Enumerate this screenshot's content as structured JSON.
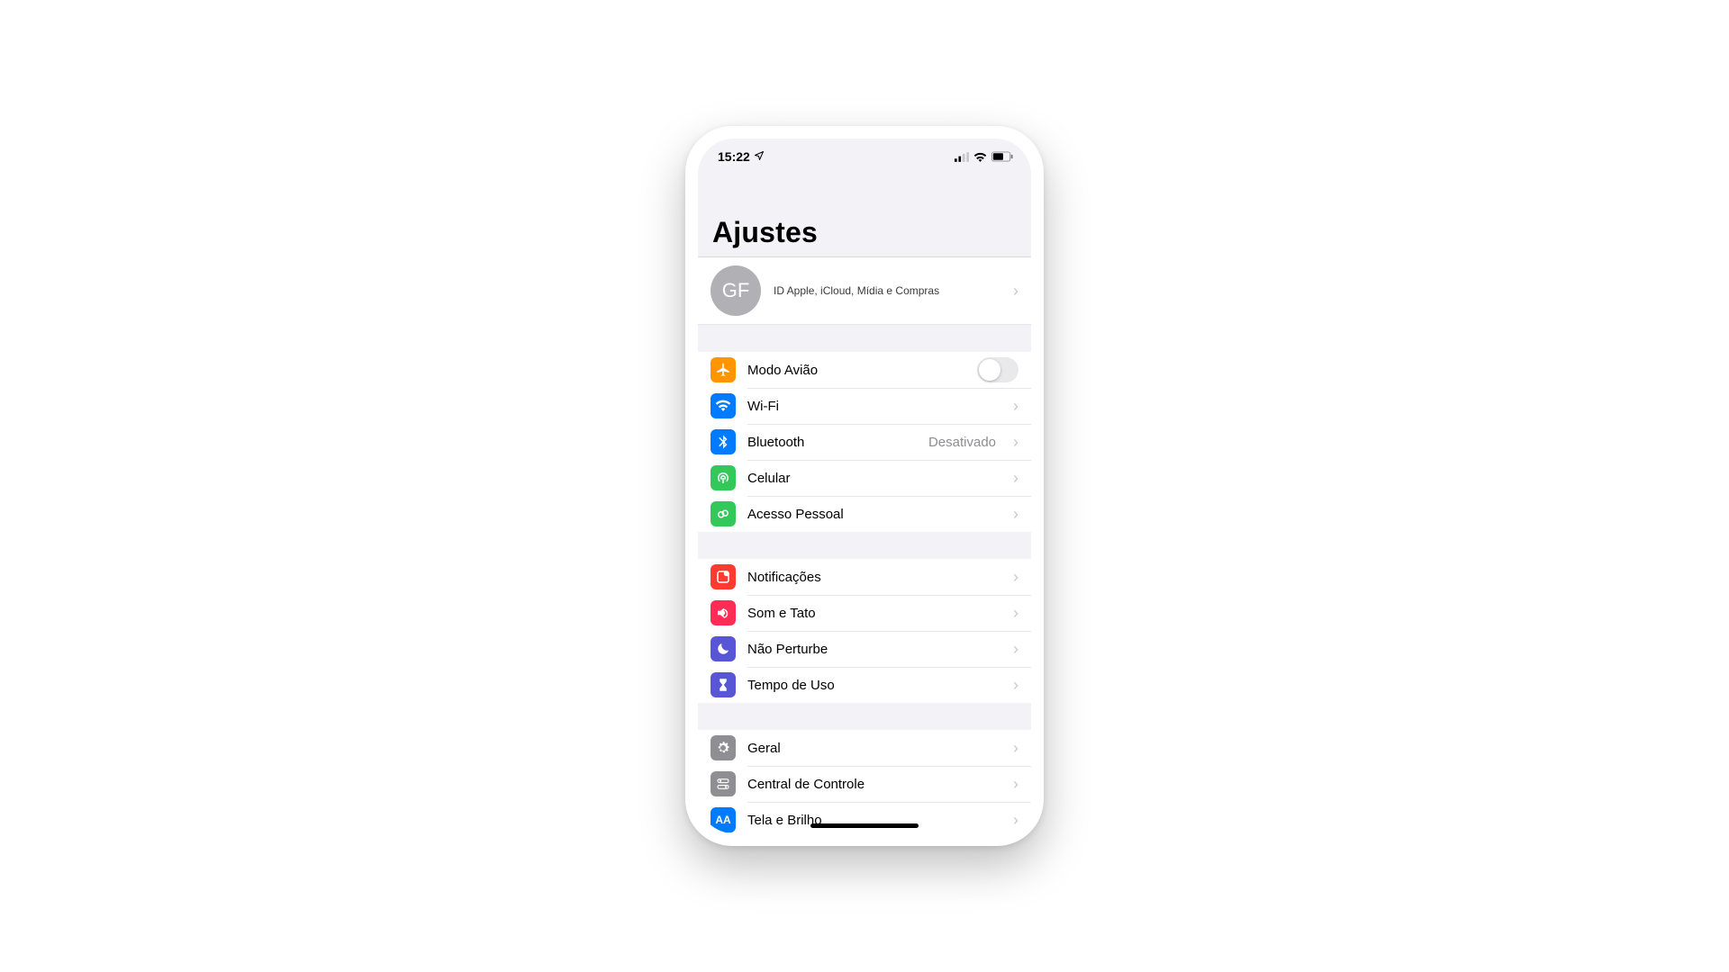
{
  "status": {
    "time": "15:22",
    "location_services": true
  },
  "header": {
    "title": "Ajustes"
  },
  "profile": {
    "initials": "GF",
    "subtitle": "ID Apple, iCloud, Mídia e Compras"
  },
  "groups": [
    {
      "id": "connectivity",
      "rows": [
        {
          "id": "airplane",
          "icon": "airplane",
          "icon_color": "#ff9500",
          "label": "Modo Avião",
          "type": "toggle",
          "toggled": false
        },
        {
          "id": "wifi",
          "icon": "wifi",
          "icon_color": "#007aff",
          "label": "Wi-Fi",
          "type": "nav",
          "value": ""
        },
        {
          "id": "bluetooth",
          "icon": "bluetooth",
          "icon_color": "#007aff",
          "label": "Bluetooth",
          "type": "nav",
          "value": "Desativado"
        },
        {
          "id": "cellular",
          "icon": "antenna",
          "icon_color": "#34c759",
          "label": "Celular",
          "type": "nav",
          "value": ""
        },
        {
          "id": "hotspot",
          "icon": "hotspot",
          "icon_color": "#34c759",
          "label": "Acesso Pessoal",
          "type": "nav",
          "value": ""
        }
      ]
    },
    {
      "id": "notifications",
      "rows": [
        {
          "id": "notifications",
          "icon": "notification",
          "icon_color": "#ff3b30",
          "label": "Notificações",
          "type": "nav",
          "value": ""
        },
        {
          "id": "sounds",
          "icon": "speaker",
          "icon_color": "#ff2d55",
          "label": "Som e Tato",
          "type": "nav",
          "value": ""
        },
        {
          "id": "dnd",
          "icon": "moon",
          "icon_color": "#5856d6",
          "label": "Não Perturbe",
          "type": "nav",
          "value": ""
        },
        {
          "id": "screentime",
          "icon": "hourglass",
          "icon_color": "#5856d6",
          "label": "Tempo de Uso",
          "type": "nav",
          "value": ""
        }
      ]
    },
    {
      "id": "general",
      "rows": [
        {
          "id": "general",
          "icon": "gear",
          "icon_color": "#8e8e93",
          "label": "Geral",
          "type": "nav",
          "value": ""
        },
        {
          "id": "controlcenter",
          "icon": "switches",
          "icon_color": "#8e8e93",
          "label": "Central de Controle",
          "type": "nav",
          "value": ""
        },
        {
          "id": "display",
          "icon": "aa",
          "icon_color": "#007aff",
          "label": "Tela e Brilho",
          "type": "nav",
          "value": ""
        }
      ]
    }
  ]
}
